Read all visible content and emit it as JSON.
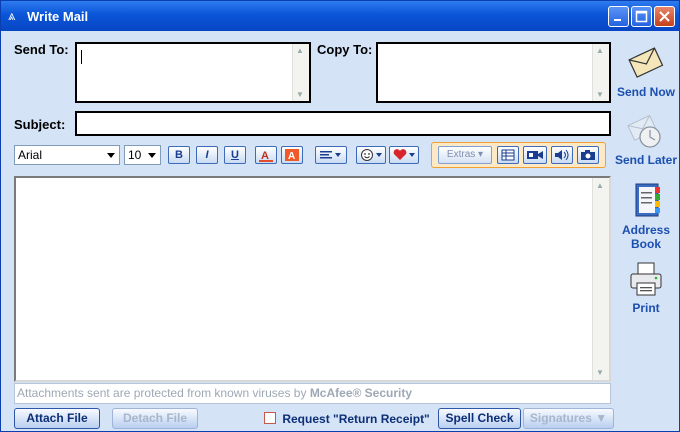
{
  "window": {
    "title": "Write Mail"
  },
  "fields": {
    "send_to_label": "Send To:",
    "copy_to_label": "Copy To:",
    "subject_label": "Subject:",
    "send_to_value": "",
    "copy_to_value": "",
    "subject_value": ""
  },
  "format_toolbar": {
    "font": "Arial",
    "size": "10",
    "bold": "B",
    "italic": "I",
    "underline": "U",
    "extras_label": "Extras"
  },
  "sidebar": {
    "send_now": "Send Now",
    "send_later": "Send Later",
    "address_book_line1": "Address",
    "address_book_line2": "Book",
    "print": "Print"
  },
  "body": {
    "message": "",
    "attachment_note_prefix": "Attachments sent are protected from known viruses by ",
    "attachment_note_brand": "McAfee® Security"
  },
  "footer": {
    "attach_file": "Attach File",
    "detach_file": "Detach File",
    "return_receipt": "Request \"Return Receipt\"",
    "spell_check": "Spell Check",
    "signatures": "Signatures ▼"
  },
  "colors": {
    "title_bar": "#0a55d8",
    "window_bg": "#d4e3f5",
    "link_blue": "#1c4fb0"
  }
}
